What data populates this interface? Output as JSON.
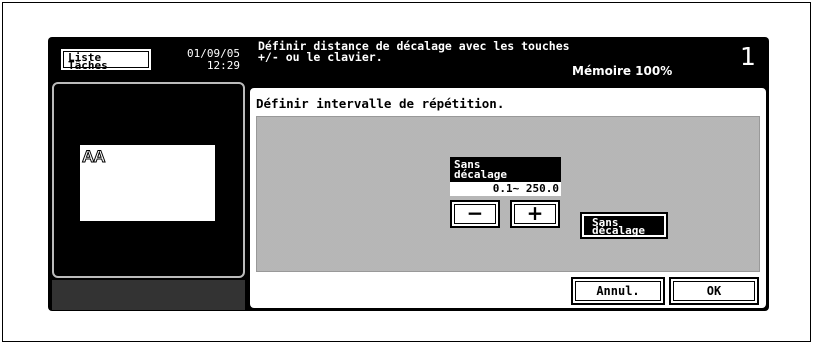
{
  "header": {
    "tasks_line1": "Liste",
    "tasks_line2": "Tâches",
    "date": "01/09/05",
    "time": "12:29",
    "message": "Définir distance de décalage avec les touches\n+/- ou le clavier.",
    "memory": "Mémoire 100%",
    "page_number": "1"
  },
  "preview": {
    "text": "AA"
  },
  "dialog": {
    "title": "Définir intervalle de répétition.",
    "spinner_label_line1": "Sans",
    "spinner_label_line2": "décalage",
    "range": "0.1~ 250.0",
    "minus": "−",
    "plus": "+",
    "no_offset_line1": "Sans",
    "no_offset_line2": "décalage",
    "cancel": "Annul.",
    "ok": "OK"
  }
}
